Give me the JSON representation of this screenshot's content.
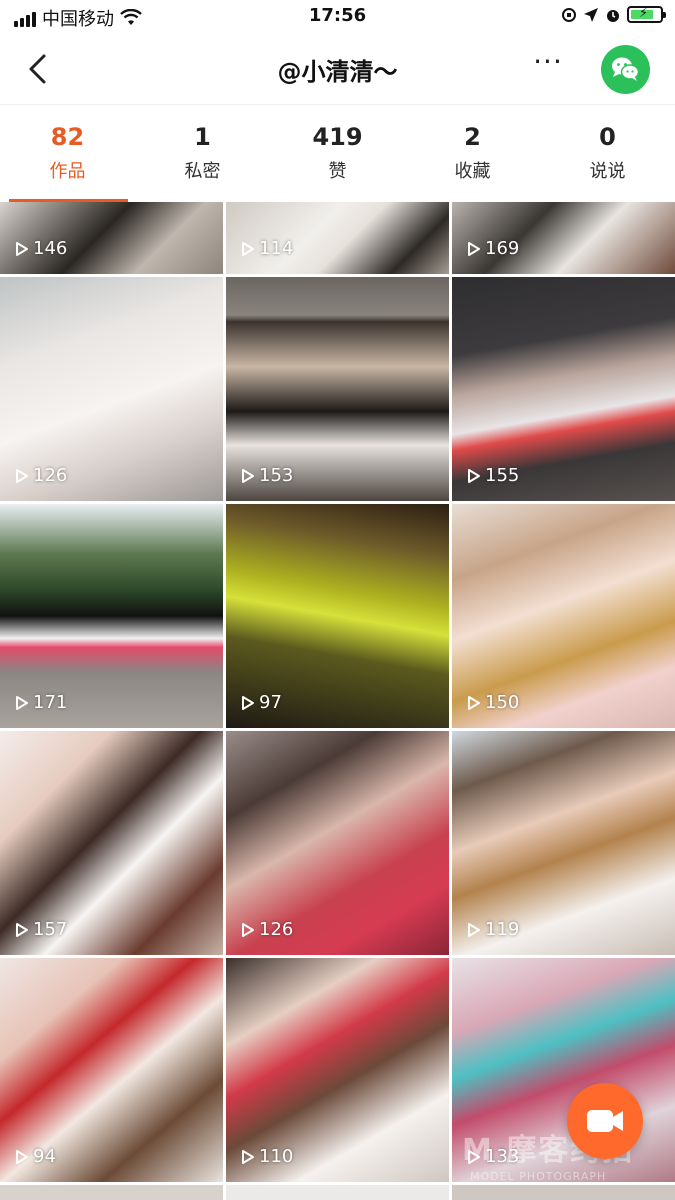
{
  "status_bar": {
    "carrier": "中国移动",
    "time": "17:56",
    "battery_level": 0.8,
    "battery_color": "#4cd964"
  },
  "nav": {
    "title": "@小清清～",
    "more_label": "···",
    "back_icon": "chevron-left-icon",
    "share_icon": "wechat-icon"
  },
  "tabs": [
    {
      "count": "82",
      "label": "作品",
      "active": true
    },
    {
      "count": "1",
      "label": "私密",
      "active": false
    },
    {
      "count": "419",
      "label": "赞",
      "active": false
    },
    {
      "count": "2",
      "label": "收藏",
      "active": false
    },
    {
      "count": "0",
      "label": "说说",
      "active": false
    }
  ],
  "accent_color": "#ea5a23",
  "videos": [
    {
      "plays": "146"
    },
    {
      "plays": "114"
    },
    {
      "plays": "169"
    },
    {
      "plays": "126"
    },
    {
      "plays": "153"
    },
    {
      "plays": "155"
    },
    {
      "plays": "171"
    },
    {
      "plays": "97"
    },
    {
      "plays": "150"
    },
    {
      "plays": "157"
    },
    {
      "plays": "126"
    },
    {
      "plays": "119"
    },
    {
      "plays": "94"
    },
    {
      "plays": "110"
    },
    {
      "plays": "133"
    }
  ],
  "fab": {
    "icon": "camera-record-icon",
    "color": "#ff6a2c"
  },
  "watermark": {
    "main": "M 摩客约拍",
    "sub": "MODEL PHOTOGRAPH"
  }
}
